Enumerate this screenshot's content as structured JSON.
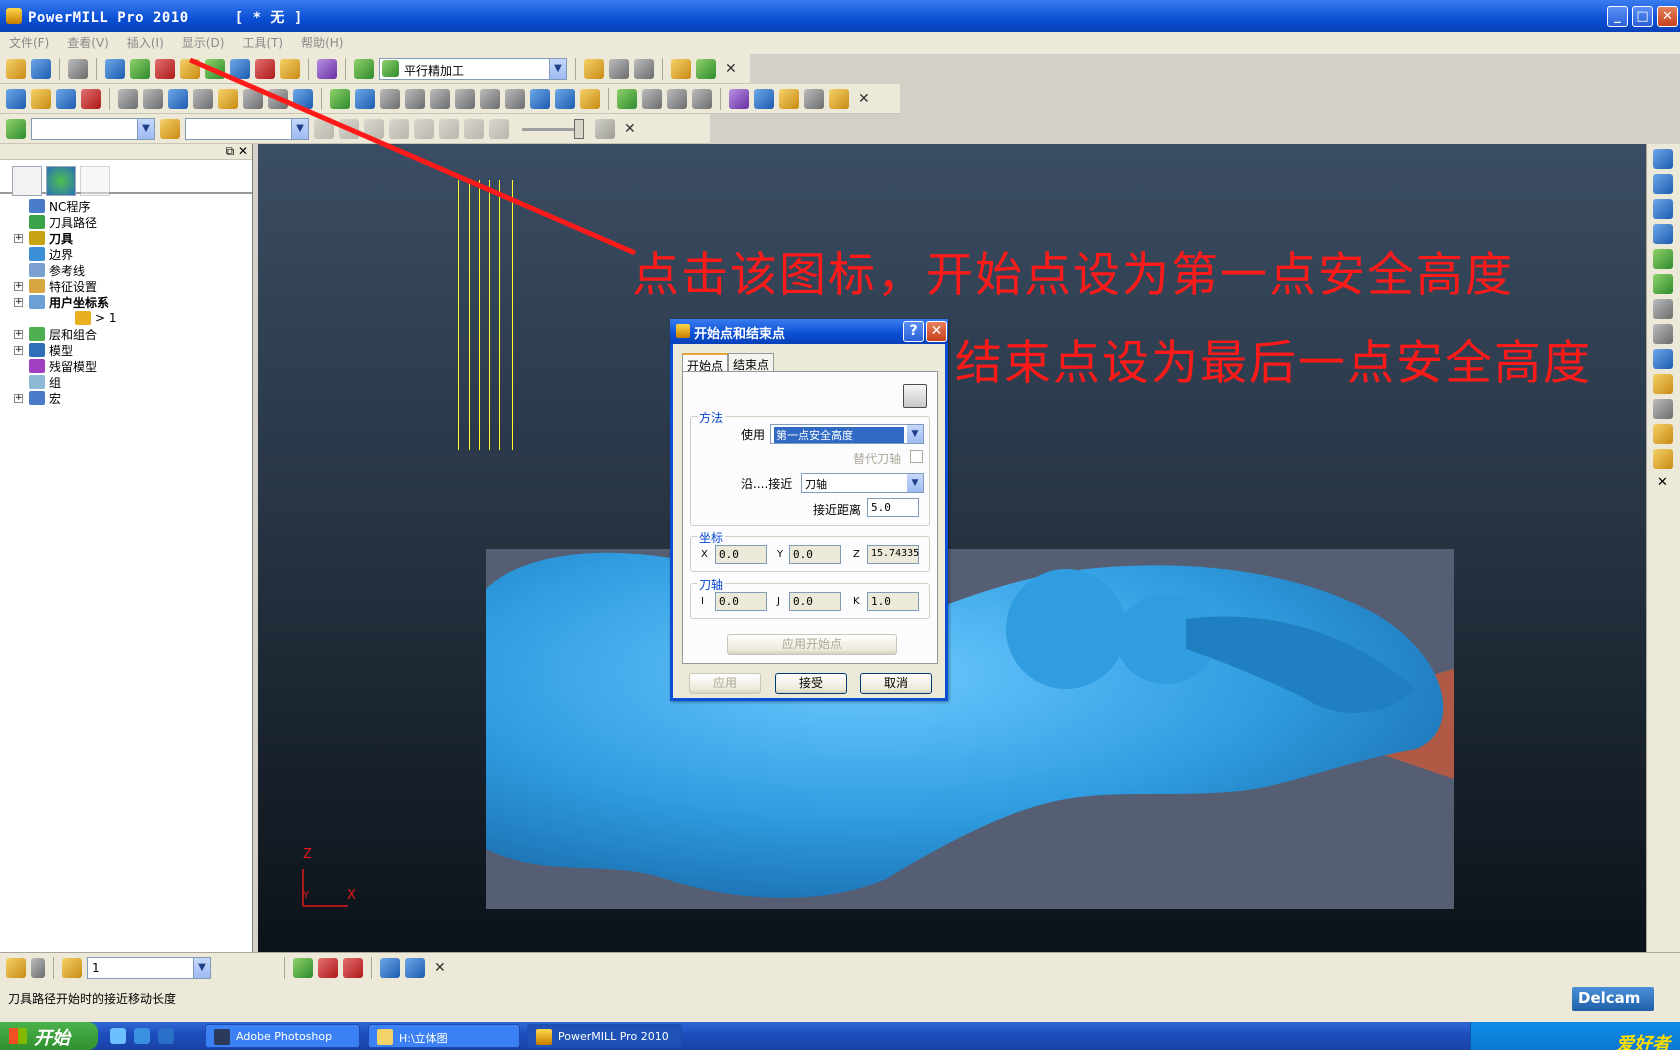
{
  "window": {
    "app_name": "PowerMILL Pro 2010",
    "doc": "[  * 无 ]"
  },
  "menu": [
    "文件(F)",
    "查看(V)",
    "插入(I)",
    "显示(D)",
    "工具(T)",
    "帮助(H)"
  ],
  "toolbar": {
    "strategy_combo": "平行精加工"
  },
  "explorer": {
    "items": [
      {
        "label": "NC程序",
        "expand": false,
        "bold": false,
        "color": "#4a7bc8"
      },
      {
        "label": "刀具路径",
        "expand": false,
        "bold": false,
        "color": "#3aa34a"
      },
      {
        "label": "刀具",
        "expand": true,
        "bold": true,
        "color": "#c7a312"
      },
      {
        "label": "边界",
        "expand": false,
        "bold": false,
        "color": "#3a8fd6"
      },
      {
        "label": "参考线",
        "expand": false,
        "bold": false,
        "color": "#7a9fd0"
      },
      {
        "label": "特征设置",
        "expand": true,
        "bold": false,
        "color": "#d6a640"
      },
      {
        "label": "用户坐标系",
        "expand": true,
        "bold": true,
        "color": "#6ba0d6"
      },
      {
        "label": "> 1",
        "expand": false,
        "bold": false,
        "child": true,
        "color": "#e8b020"
      },
      {
        "label": "层和组合",
        "expand": true,
        "bold": false,
        "color": "#4fae4f"
      },
      {
        "label": "模型",
        "expand": true,
        "bold": false,
        "color": "#2f6fb8"
      },
      {
        "label": "残留模型",
        "expand": false,
        "bold": false,
        "color": "#a040c0"
      },
      {
        "label": "组",
        "expand": false,
        "bold": false,
        "color": "#8fb8d6"
      },
      {
        "label": "宏",
        "expand": true,
        "bold": false,
        "color": "#4a7bc8"
      }
    ]
  },
  "annotations": {
    "line1": "点击该图标，开始点设为第一点安全高度",
    "line2": "结束点设为最后一点安全高度"
  },
  "viewport": {
    "axis_z": "Z",
    "axis_x": "X",
    "axis_y": "Y"
  },
  "dialog": {
    "title": "开始点和结束点",
    "help": "?",
    "close": "✕",
    "tabs": [
      "开始点",
      "结束点"
    ],
    "method_group": "方法",
    "use_label": "使用",
    "use_value": "第一点安全高度",
    "alt_axis_label": "替代刀轴",
    "approach_label": "沿....接近",
    "approach_value": "刀轴",
    "approach_dist_label": "接近距离",
    "approach_dist_value": "5.0",
    "coord_group": "坐标",
    "x_label": "X",
    "x_value": "0.0",
    "y_label": "Y",
    "y_value": "0.0",
    "z_label": "Z",
    "z_value": "15.74335",
    "axis_group": "刀轴",
    "i_label": "I",
    "i_value": "0.0",
    "j_label": "J",
    "j_value": "0.0",
    "k_label": "K",
    "k_value": "1.0",
    "apply_start": "应用开始点",
    "apply": "应用",
    "accept": "接受",
    "cancel": "取消"
  },
  "bottom_toolbar": {
    "combo_value": "1"
  },
  "status": {
    "text": "刀具路径开始时的接近移动长度",
    "brand": "Delcam"
  },
  "taskbar": {
    "start": "开始",
    "tasks": [
      "Adobe Photoshop",
      "H:\\立体图",
      "PowerMILL Pro 2010 ..."
    ],
    "watermark": "爱好者"
  }
}
